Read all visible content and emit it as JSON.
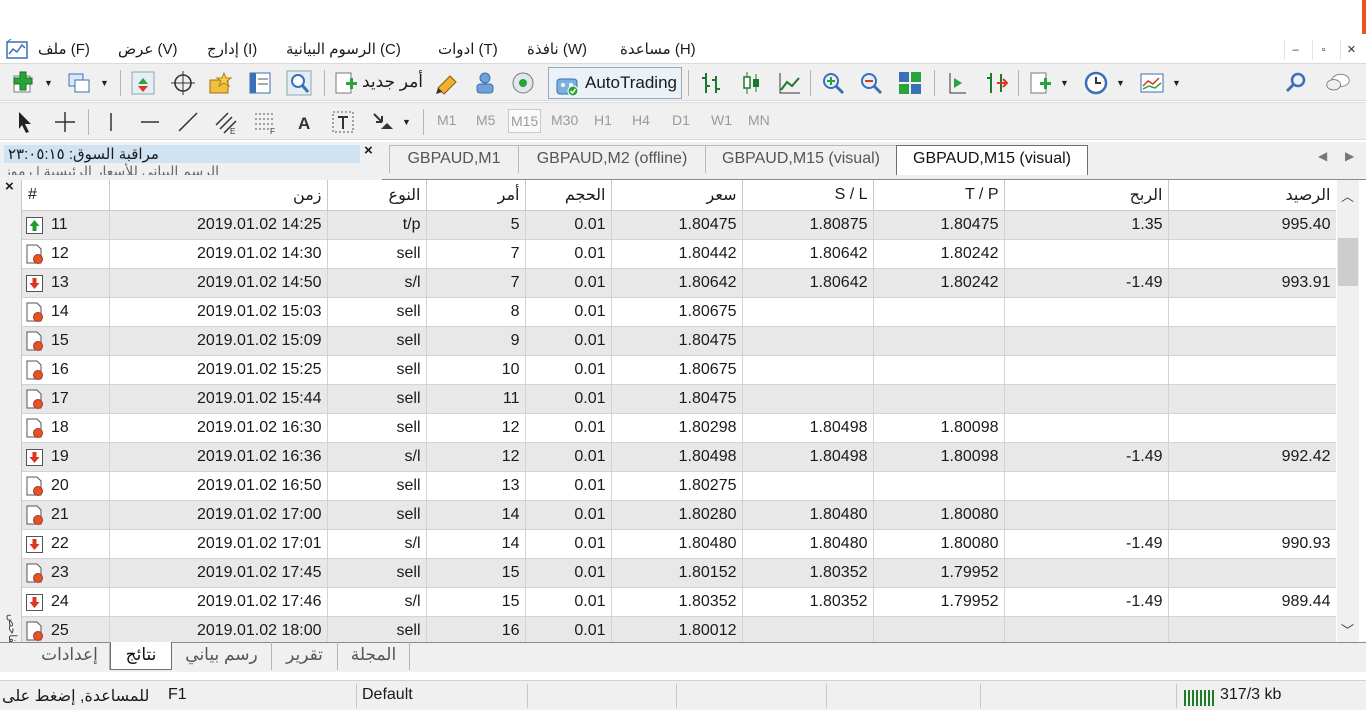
{
  "menu": {
    "file": "ملف (F)",
    "view": "عرض (V)",
    "insert": "إدارج (I)",
    "charts": "الرسوم البيانية (C)",
    "tools": "ادوات (T)",
    "window": "نافذة (W)",
    "help": "مساعدة (H)"
  },
  "window_controls": {
    "minimize": "–",
    "restore": "▫",
    "close": "✕"
  },
  "toolbar": {
    "new_order": "أمر جديد",
    "autotrading": "AutoTrading"
  },
  "timeframes": [
    "M1",
    "M5",
    "M15",
    "M30",
    "H1",
    "H4",
    "D1",
    "W1",
    "MN"
  ],
  "active_timeframe": "M15",
  "market_watch": {
    "title": "مراقبة السوق: ٢٣:٠٥:١٥",
    "tabs_partial": "الرسم البياني للأسعار الرئيسية | رموز"
  },
  "chart_tabs": [
    {
      "label": "GBPAUD,M1",
      "active": false
    },
    {
      "label": "GBPAUD,M2 (offline)",
      "active": false
    },
    {
      "label": "GBPAUD,M15 (visual)",
      "active": false
    },
    {
      "label": "GBPAUD,M15 (visual)",
      "active": true
    }
  ],
  "table": {
    "headers": {
      "num": "#",
      "time": "زمن",
      "type": "النوع",
      "order": "أمر",
      "volume": "الحجم",
      "price": "سعر",
      "sl": "S / L",
      "tp": "T / P",
      "profit": "الربح",
      "balance": "الرصيد"
    },
    "rows": [
      {
        "num": "11",
        "icon": "tp-up-icon",
        "time": "2019.01.02 14:25",
        "type": "t/p",
        "order": "5",
        "volume": "0.01",
        "price": "1.80475",
        "sl": "1.80875",
        "tp": "1.80475",
        "profit": "1.35",
        "balance": "995.40"
      },
      {
        "num": "12",
        "icon": "sell-order-icon",
        "time": "2019.01.02 14:30",
        "type": "sell",
        "order": "7",
        "volume": "0.01",
        "price": "1.80442",
        "sl": "1.80642",
        "tp": "1.80242",
        "profit": "",
        "balance": ""
      },
      {
        "num": "13",
        "icon": "sl-down-icon",
        "time": "2019.01.02 14:50",
        "type": "s/l",
        "order": "7",
        "volume": "0.01",
        "price": "1.80642",
        "sl": "1.80642",
        "tp": "1.80242",
        "profit": "-1.49",
        "balance": "993.91"
      },
      {
        "num": "14",
        "icon": "sell-order-icon",
        "time": "2019.01.02 15:03",
        "type": "sell",
        "order": "8",
        "volume": "0.01",
        "price": "1.80675",
        "sl": "",
        "tp": "",
        "profit": "",
        "balance": ""
      },
      {
        "num": "15",
        "icon": "sell-order-icon",
        "time": "2019.01.02 15:09",
        "type": "sell",
        "order": "9",
        "volume": "0.01",
        "price": "1.80475",
        "sl": "",
        "tp": "",
        "profit": "",
        "balance": ""
      },
      {
        "num": "16",
        "icon": "sell-order-icon",
        "time": "2019.01.02 15:25",
        "type": "sell",
        "order": "10",
        "volume": "0.01",
        "price": "1.80675",
        "sl": "",
        "tp": "",
        "profit": "",
        "balance": ""
      },
      {
        "num": "17",
        "icon": "sell-order-icon",
        "time": "2019.01.02 15:44",
        "type": "sell",
        "order": "11",
        "volume": "0.01",
        "price": "1.80475",
        "sl": "",
        "tp": "",
        "profit": "",
        "balance": ""
      },
      {
        "num": "18",
        "icon": "sell-order-icon",
        "time": "2019.01.02 16:30",
        "type": "sell",
        "order": "12",
        "volume": "0.01",
        "price": "1.80298",
        "sl": "1.80498",
        "tp": "1.80098",
        "profit": "",
        "balance": ""
      },
      {
        "num": "19",
        "icon": "sl-down-icon",
        "time": "2019.01.02 16:36",
        "type": "s/l",
        "order": "12",
        "volume": "0.01",
        "price": "1.80498",
        "sl": "1.80498",
        "tp": "1.80098",
        "profit": "-1.49",
        "balance": "992.42"
      },
      {
        "num": "20",
        "icon": "sell-order-icon",
        "time": "2019.01.02 16:50",
        "type": "sell",
        "order": "13",
        "volume": "0.01",
        "price": "1.80275",
        "sl": "",
        "tp": "",
        "profit": "",
        "balance": ""
      },
      {
        "num": "21",
        "icon": "sell-order-icon",
        "time": "2019.01.02 17:00",
        "type": "sell",
        "order": "14",
        "volume": "0.01",
        "price": "1.80280",
        "sl": "1.80480",
        "tp": "1.80080",
        "profit": "",
        "balance": ""
      },
      {
        "num": "22",
        "icon": "sl-down-icon",
        "time": "2019.01.02 17:01",
        "type": "s/l",
        "order": "14",
        "volume": "0.01",
        "price": "1.80480",
        "sl": "1.80480",
        "tp": "1.80080",
        "profit": "-1.49",
        "balance": "990.93"
      },
      {
        "num": "23",
        "icon": "sell-order-icon",
        "time": "2019.01.02 17:45",
        "type": "sell",
        "order": "15",
        "volume": "0.01",
        "price": "1.80152",
        "sl": "1.80352",
        "tp": "1.79952",
        "profit": "",
        "balance": ""
      },
      {
        "num": "24",
        "icon": "sl-down-icon",
        "time": "2019.01.02 17:46",
        "type": "s/l",
        "order": "15",
        "volume": "0.01",
        "price": "1.80352",
        "sl": "1.80352",
        "tp": "1.79952",
        "profit": "-1.49",
        "balance": "989.44"
      },
      {
        "num": "25",
        "icon": "sell-order-icon",
        "time": "2019.01.02 18:00",
        "type": "sell",
        "order": "16",
        "volume": "0.01",
        "price": "1.80012",
        "sl": "",
        "tp": "",
        "profit": "",
        "balance": ""
      }
    ]
  },
  "side_label": "الفاحص",
  "bottom_tabs": [
    {
      "label": "إعدادات",
      "active": false
    },
    {
      "label": "نتائج",
      "active": true
    },
    {
      "label": "رسم بياني",
      "active": false
    },
    {
      "label": "تقرير",
      "active": false
    },
    {
      "label": "المجلة",
      "active": false
    }
  ],
  "status": {
    "help": "للمساعدة, إضغط على",
    "help_key": "F1",
    "profile": "Default",
    "traffic": "317/3 kb"
  },
  "colors": {
    "accent_orange": "#f0531c",
    "up_green": "#1f9a2c",
    "down_red": "#d9381e",
    "row_alt": "#e8e8e8"
  }
}
